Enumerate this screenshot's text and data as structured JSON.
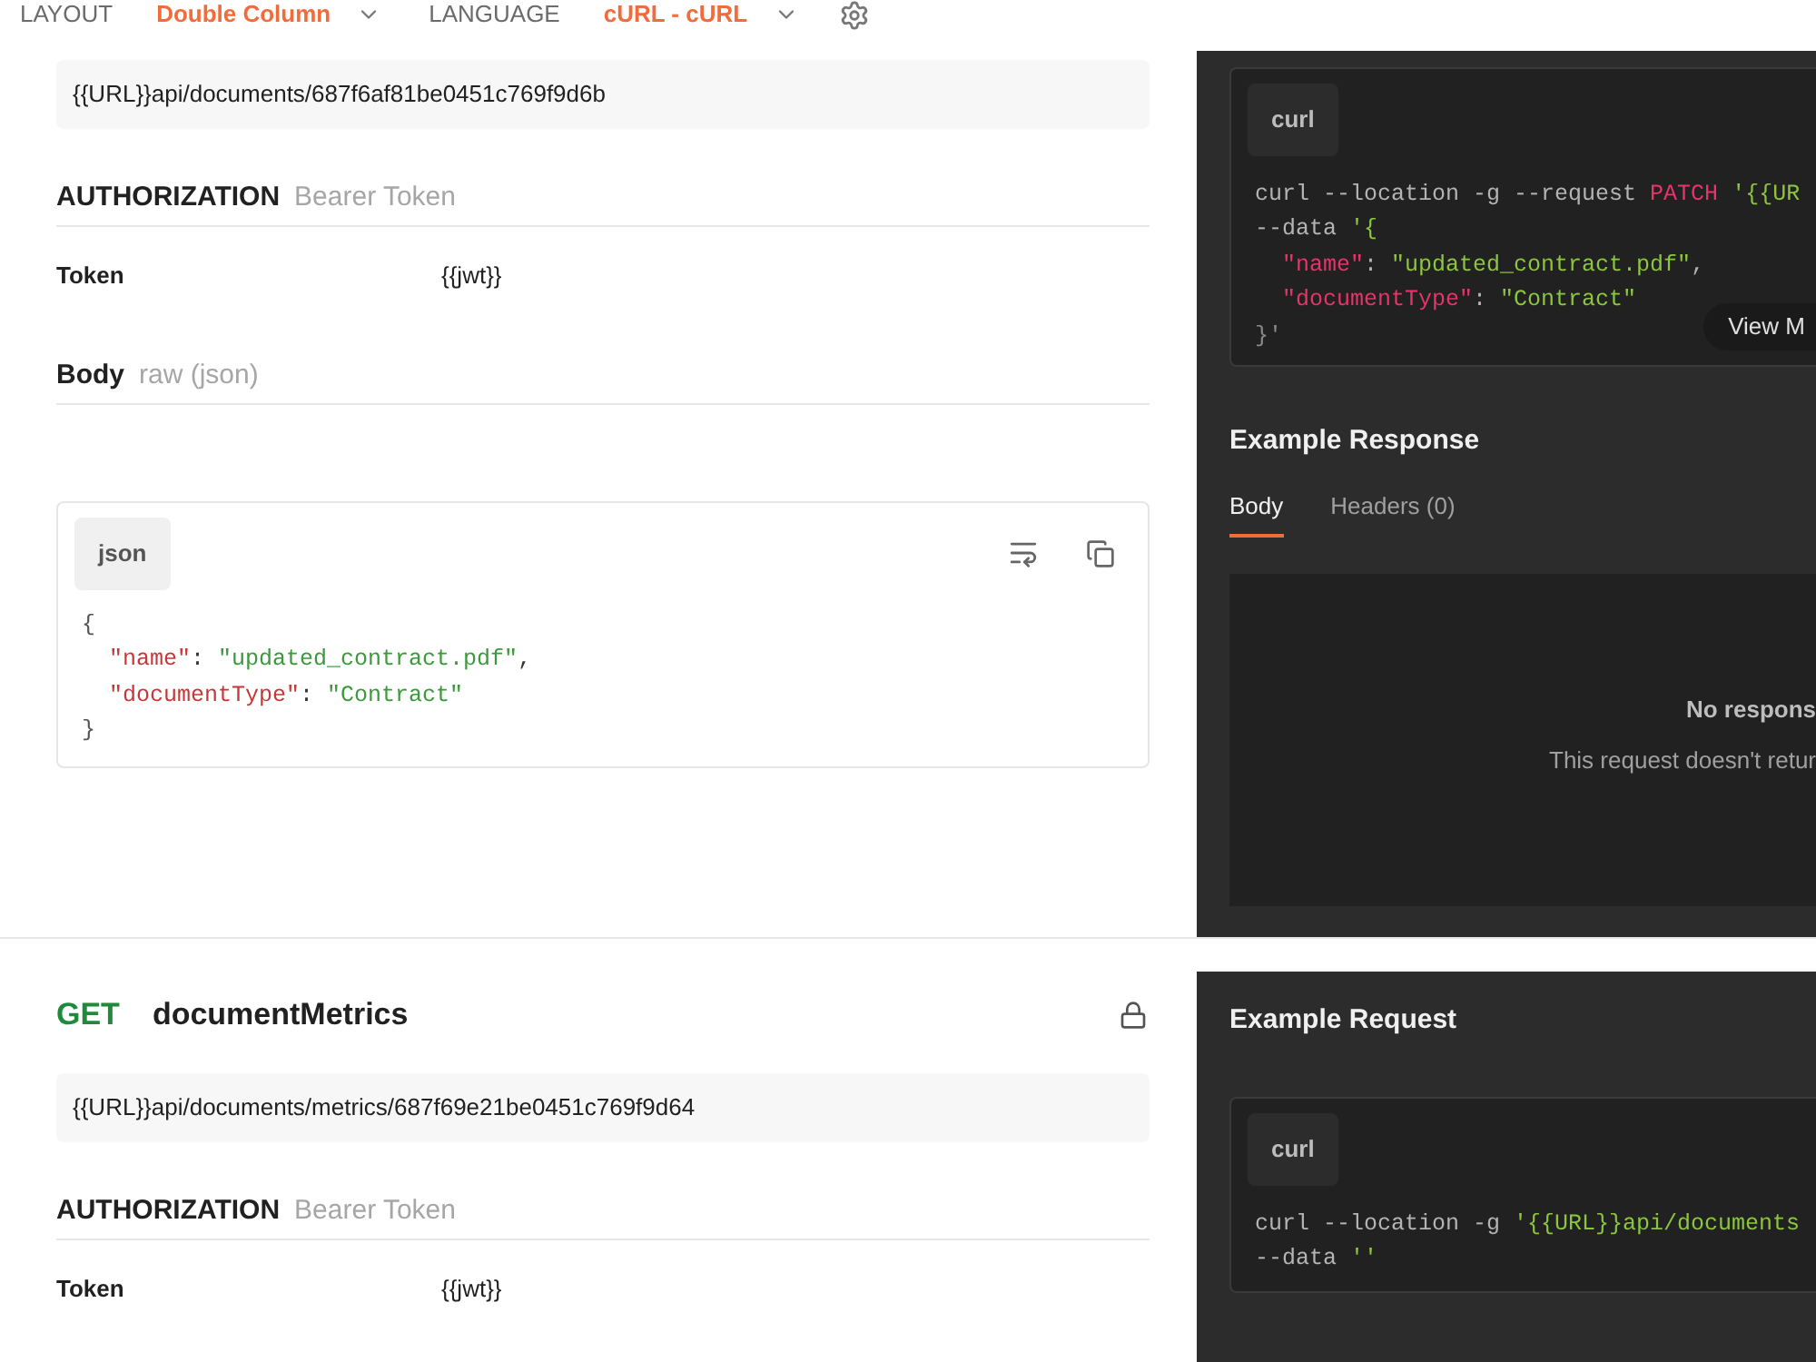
{
  "toolbar": [
    {
      "label": "LAYOUT",
      "value": "Double Column"
    },
    {
      "label": "LANGUAGE",
      "value": "cURL - cURL"
    }
  ],
  "sections": [
    {
      "url": "{{URL}}api/documents/687f6af81be0451c769f9d6b",
      "authorization": {
        "label": "AUTHORIZATION",
        "type": "Bearer Token"
      },
      "params": [
        {
          "key": "Token",
          "value": "{{jwt}}"
        }
      ],
      "body": {
        "label": "Body",
        "type": "raw (json)",
        "language": "json",
        "lines": [
          [
            {
              "kind": "punct",
              "text": "{"
            }
          ],
          [
            {
              "kind": "key",
              "text": "  \"name\""
            },
            {
              "kind": "plain",
              "text": ": "
            },
            {
              "kind": "string",
              "text": "\"updated_contract.pdf\""
            },
            {
              "kind": "plain",
              "text": ","
            }
          ],
          [
            {
              "kind": "key",
              "text": "  \"documentType\""
            },
            {
              "kind": "plain",
              "text": ": "
            },
            {
              "kind": "string",
              "text": "\"Contract\""
            }
          ],
          [
            {
              "kind": "punct",
              "text": "}"
            }
          ]
        ]
      },
      "example": {
        "language": "curl",
        "view_more": "View M",
        "lines": [
          [
            {
              "kind": "plain",
              "text": "curl --location -g --request "
            },
            {
              "kind": "keyword",
              "text": "PATCH"
            },
            {
              "kind": "string",
              "text": " '{{UR"
            }
          ],
          [
            {
              "kind": "plain",
              "text": "--data "
            },
            {
              "kind": "string",
              "text": "'{"
            }
          ],
          [
            {
              "kind": "key",
              "text": "  \"name\""
            },
            {
              "kind": "plain",
              "text": ": "
            },
            {
              "kind": "string",
              "text": "\"updated_contract.pdf\""
            },
            {
              "kind": "plain",
              "text": ","
            }
          ],
          [
            {
              "kind": "key",
              "text": "  \"documentType\""
            },
            {
              "kind": "plain",
              "text": ": "
            },
            {
              "kind": "string",
              "text": "\"Contract\""
            }
          ],
          [
            {
              "kind": "punct",
              "text": "}'"
            }
          ]
        ],
        "response": {
          "title": "Example Response",
          "tabs": [
            {
              "label": "Body",
              "selected": true
            },
            {
              "label": "Headers (0)",
              "selected": false
            }
          ],
          "empty_title": "No respons",
          "empty_message": "This request doesn't retur"
        }
      }
    },
    {
      "method": "GET",
      "name": "documentMetrics",
      "locked": true,
      "url": "{{URL}}api/documents/metrics/687f69e21be0451c769f9d64",
      "authorization": {
        "label": "AUTHORIZATION",
        "type": "Bearer Token"
      },
      "params": [
        {
          "key": "Token",
          "value": "{{jwt}}"
        }
      ],
      "example": {
        "title": "Example Request",
        "language": "curl",
        "lines": [
          [
            {
              "kind": "plain",
              "text": "curl --location -g "
            },
            {
              "kind": "string",
              "text": "'{{URL}}api/documents"
            }
          ],
          [
            {
              "kind": "plain",
              "text": "--data "
            },
            {
              "kind": "string",
              "text": "''"
            }
          ]
        ]
      }
    }
  ]
}
